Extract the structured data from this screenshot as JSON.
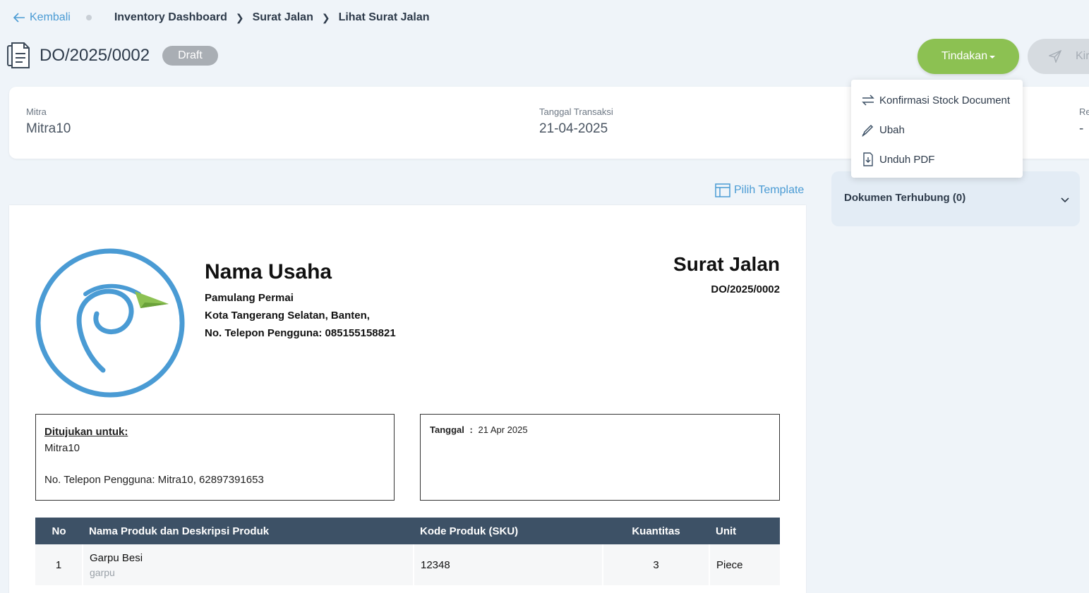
{
  "breadcrumb": {
    "back_label": "Kembali",
    "items": [
      "Inventory Dashboard",
      "Surat Jalan",
      "Lihat Surat Jalan"
    ]
  },
  "header": {
    "doc_number": "DO/2025/0002",
    "status": "Draft",
    "actions_label": "Tindakan",
    "send_label": "Kirim"
  },
  "info": {
    "partner_label": "Mitra",
    "partner_value": "Mitra10",
    "date_label": "Tanggal Transaksi",
    "date_value": "21-04-2025",
    "ref_label": "Re",
    "ref_value": "-"
  },
  "dropdown": {
    "items": [
      "Konfirmasi Stock Document",
      "Ubah",
      "Unduh PDF"
    ]
  },
  "linked": {
    "title": "Dokumen Terhubung (0)"
  },
  "template": {
    "label": "Pilih Template"
  },
  "paper": {
    "business_name": "Nama Usaha",
    "address1": "Pamulang Permai",
    "address2": "Kota Tangerang Selatan, Banten,",
    "phone": "No. Telepon Pengguna: 085155158821",
    "doc_type": "Surat Jalan",
    "doc_number": "DO/2025/0002",
    "to_label": "Ditujukan untuk:",
    "to_name": "Mitra10",
    "to_phone": "No. Telepon Pengguna: Mitra10, 62897391653",
    "date_label": "Tanggal",
    "date_sep": ":",
    "date_value": "21 Apr 2025"
  },
  "table": {
    "headers": [
      "No",
      "Nama Produk dan Deskripsi Produk",
      "Kode Produk (SKU)",
      "Kuantitas",
      "Unit"
    ],
    "rows": [
      {
        "no": "1",
        "name": "Garpu Besi",
        "desc": "garpu",
        "sku": "12348",
        "qty": "3",
        "unit": "Piece"
      }
    ]
  },
  "colors": {
    "accent": "#8cc152",
    "link": "#4a9bd4",
    "table_header": "#3d5166",
    "logo_blue": "#4a9bd4",
    "logo_green": "#8cc152"
  }
}
